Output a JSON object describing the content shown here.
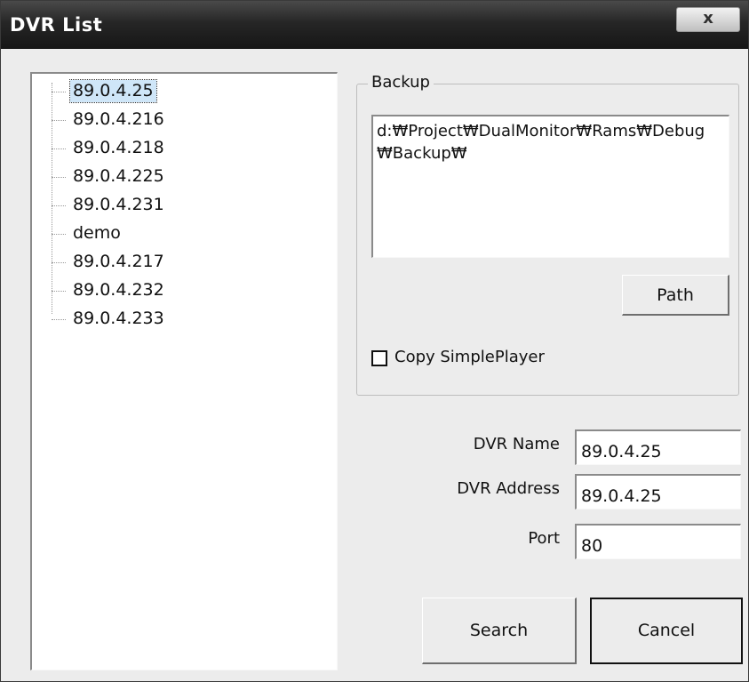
{
  "window": {
    "title": "DVR List",
    "close_label": "x"
  },
  "dvr_list": {
    "items": [
      {
        "label": "89.0.4.25",
        "selected": true
      },
      {
        "label": "89.0.4.216",
        "selected": false
      },
      {
        "label": "89.0.4.218",
        "selected": false
      },
      {
        "label": "89.0.4.225",
        "selected": false
      },
      {
        "label": "89.0.4.231",
        "selected": false
      },
      {
        "label": "demo",
        "selected": false
      },
      {
        "label": "89.0.4.217",
        "selected": false
      },
      {
        "label": "89.0.4.232",
        "selected": false
      },
      {
        "label": "89.0.4.233",
        "selected": false
      }
    ]
  },
  "backup": {
    "group_label": "Backup",
    "path_value": "d:₩Project₩DualMonitor₩Rams₩Debug₩Backup₩",
    "path_button_label": "Path",
    "copy_simpleplayer_label": "Copy SimplePlayer",
    "copy_simpleplayer_checked": false
  },
  "form": {
    "dvr_name_label": "DVR Name",
    "dvr_name_value": "89.0.4.25",
    "dvr_address_label": "DVR Address",
    "dvr_address_value": "89.0.4.25",
    "port_label": "Port",
    "port_value": "80"
  },
  "actions": {
    "search_label": "Search",
    "cancel_label": "Cancel"
  },
  "colors": {
    "titlebar": "#1e1e1e",
    "selection": "#cfe6f8",
    "dialog_bg": "#ececec"
  }
}
